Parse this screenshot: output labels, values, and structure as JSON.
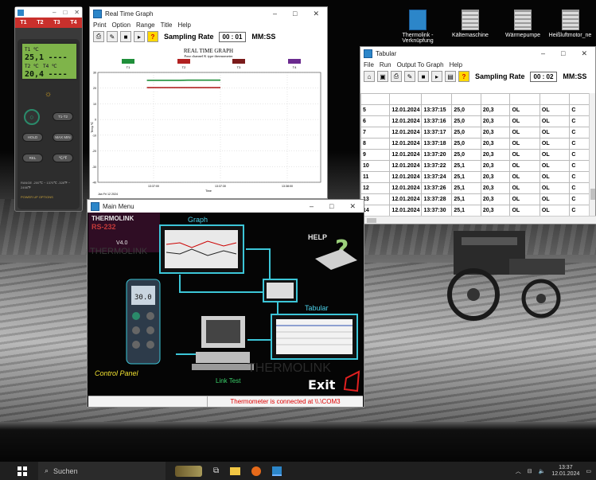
{
  "desktop": {
    "icons": [
      {
        "label": "Thermolink - Verknüpfung"
      },
      {
        "label": "Kältemaschine"
      },
      {
        "label": "Wärmepumpe"
      },
      {
        "label": "Heißluftmotor_ne"
      }
    ]
  },
  "meter": {
    "tabs": [
      "T1",
      "T2",
      "T3",
      "T4"
    ],
    "t1_label": "T1 ℃",
    "t1_value": "25,1",
    "t2_label": "T2 ℃",
    "t4_label": "T4 ℃",
    "t2_value": "20,4",
    "dash": "----",
    "buttons": [
      "T1-T2",
      "HOLD",
      "MAX MIN",
      "REL",
      "℃/℉"
    ],
    "range_text": "RANGE  -200℃ ~ 1370℃   -328℉ ~ 2498℉",
    "brand": "POWER UP OPTIONS"
  },
  "graph": {
    "title": "Real Time Graph",
    "menu": [
      "Print",
      "Option",
      "Range",
      "Title",
      "Help"
    ],
    "sampling_label": "Sampling Rate",
    "sampling_value": "00 : 01",
    "sampling_unit": "MM:SS",
    "chart_data": {
      "type": "line",
      "title": "REAL TIME GRAPH",
      "subtitle": "Four channel K type thermometer",
      "legend": [
        "T1",
        "T2",
        "T3",
        "T4"
      ],
      "colors": [
        "#1f8f3a",
        "#b22222",
        "#7a1b1b",
        "#6b2b8f"
      ],
      "ylabel": "Temp ℃",
      "xlabel": "Time",
      "ylim": [
        -40,
        30
      ],
      "yticks": [
        30,
        20,
        10,
        0,
        -10,
        -20,
        -30,
        -40
      ],
      "xticks": [
        "13:37:00",
        "13:37:30",
        "13:38:00"
      ],
      "date_label": "Jan Fri 12 2024",
      "series": [
        {
          "name": "T1",
          "values": [
            25.0,
            25.0,
            25.0,
            25.0,
            25.0,
            25.1,
            25.1,
            25.1,
            25.1,
            25.1
          ]
        },
        {
          "name": "T2",
          "values": [
            20.3,
            20.3,
            20.3,
            20.3,
            20.3,
            20.3,
            20.3,
            20.3,
            20.3,
            20.3
          ]
        }
      ],
      "x": [
        "13:37:15",
        "13:37:16",
        "13:37:17",
        "13:37:18",
        "13:37:20",
        "13:37:22",
        "13:37:24",
        "13:37:26",
        "13:37:28",
        "13:37:30"
      ]
    }
  },
  "tabular": {
    "title": "Tabular",
    "menu": [
      "File",
      "Run",
      "Output To Graph",
      "Help"
    ],
    "sampling_label": "Sampling Rate",
    "sampling_value": "00 : 02",
    "sampling_unit": "MM:SS",
    "rows": [
      [
        "5",
        "12.01.2024",
        "13:37:15",
        "25,0",
        "20,3",
        "OL",
        "OL",
        "C"
      ],
      [
        "6",
        "12.01.2024",
        "13:37:16",
        "25,0",
        "20,3",
        "OL",
        "OL",
        "C"
      ],
      [
        "7",
        "12.01.2024",
        "13:37:17",
        "25,0",
        "20,3",
        "OL",
        "OL",
        "C"
      ],
      [
        "8",
        "12.01.2024",
        "13:37:18",
        "25,0",
        "20,3",
        "OL",
        "OL",
        "C"
      ],
      [
        "9",
        "12.01.2024",
        "13:37:20",
        "25,0",
        "20,3",
        "OL",
        "OL",
        "C"
      ],
      [
        "10",
        "12.01.2024",
        "13:37:22",
        "25,1",
        "20,3",
        "OL",
        "OL",
        "C"
      ],
      [
        "11",
        "12.01.2024",
        "13:37:24",
        "25,1",
        "20,3",
        "OL",
        "OL",
        "C"
      ],
      [
        "12",
        "12.01.2024",
        "13:37:26",
        "25,1",
        "20,3",
        "OL",
        "OL",
        "C"
      ],
      [
        "13",
        "12.01.2024",
        "13:37:28",
        "25,1",
        "20,3",
        "OL",
        "OL",
        "C"
      ],
      [
        "14",
        "12.01.2024",
        "13:37:30",
        "25,1",
        "20,3",
        "OL",
        "OL",
        "C"
      ]
    ]
  },
  "mainmenu": {
    "title": "Main Menu",
    "brand": "THERMOLINK",
    "port": "RS-232",
    "version": "V4.0",
    "graph_label": "Graph",
    "help_label": "HELP",
    "tabular_label": "Tabular",
    "control_label": "Control Panel",
    "link_label": "Link Test",
    "exit_label": "Exit",
    "meter_reading": "30.0",
    "status": "Thermometer is connected at \\\\.\\COM3"
  },
  "taskbar": {
    "search_placeholder": "Suchen",
    "time": "13:37",
    "date": "12.01.2024"
  }
}
